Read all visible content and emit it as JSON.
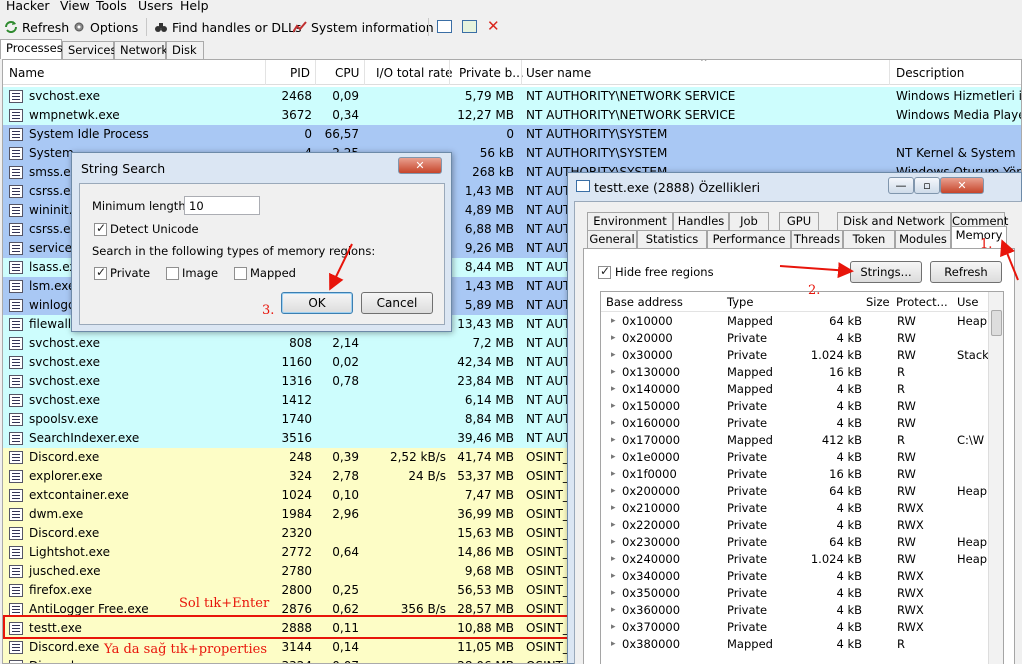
{
  "menu": [
    "Hacker",
    "View",
    "Tools",
    "Users",
    "Help"
  ],
  "toolbar": {
    "refresh": "Refresh",
    "options": "Options",
    "find": "Find handles or DLLs",
    "sysinfo": "System information"
  },
  "tabs": [
    "Processes",
    "Services",
    "Network",
    "Disk"
  ],
  "columns": {
    "name": "Name",
    "pid": "PID",
    "cpu": "CPU",
    "io": "I/O total rate",
    "private": "Private b...",
    "user": "User name",
    "desc": "Description"
  },
  "colors": {
    "service": "#cdfdfd",
    "system": "#a9c8f4",
    "user": "#fdfdc6",
    "highlight": "#e8150b"
  },
  "processes": [
    {
      "name": "svchost.exe",
      "pid": "2468",
      "cpu": "0,09",
      "io": "",
      "priv": "5,79 MB",
      "user": "NT AUTHORITY\\NETWORK SERVICE",
      "desc": "Windows Hizmetleri için",
      "kind": "service"
    },
    {
      "name": "wmpnetwk.exe",
      "pid": "3672",
      "cpu": "0,34",
      "io": "",
      "priv": "12,27 MB",
      "user": "NT AUTHORITY\\NETWORK SERVICE",
      "desc": "Windows Media Player A",
      "kind": "service"
    },
    {
      "name": "System Idle Process",
      "pid": "0",
      "cpu": "66,57",
      "io": "",
      "priv": "0",
      "user": "NT AUTHORITY\\SYSTEM",
      "desc": "",
      "kind": "system"
    },
    {
      "name": "System",
      "pid": "4",
      "cpu": "2,25",
      "io": "",
      "priv": "56 kB",
      "user": "NT AUTHORITY\\SYSTEM",
      "desc": "NT Kernel & System",
      "kind": "system"
    },
    {
      "name": "smss.exe",
      "pid": "",
      "cpu": "",
      "io": "",
      "priv": "268 kB",
      "user": "NT AUTHORITY\\SYSTEM",
      "desc": "Windows Oturum Yönet",
      "kind": "system"
    },
    {
      "name": "csrss.exe",
      "pid": "",
      "cpu": "",
      "io": "",
      "priv": "1,43 MB",
      "user": "NT AUTH",
      "desc": "",
      "kind": "system"
    },
    {
      "name": "wininit.exe",
      "pid": "",
      "cpu": "",
      "io": "",
      "priv": "4,89 MB",
      "user": "NT AUTH",
      "desc": "",
      "kind": "system"
    },
    {
      "name": "csrss.exe",
      "pid": "",
      "cpu": "",
      "io": "",
      "priv": "6,88 MB",
      "user": "NT AUTH",
      "desc": "",
      "kind": "system"
    },
    {
      "name": "services.exe",
      "pid": "",
      "cpu": "",
      "io": "",
      "priv": "9,26 MB",
      "user": "NT AUTH",
      "desc": "",
      "kind": "system"
    },
    {
      "name": "lsass.exe",
      "pid": "",
      "cpu": "",
      "io": "",
      "priv": "8,44 MB",
      "user": "NT AUTH",
      "desc": "",
      "kind": "service"
    },
    {
      "name": "lsm.exe",
      "pid": "",
      "cpu": "",
      "io": "",
      "priv": "1,43 MB",
      "user": "NT AUTH",
      "desc": "",
      "kind": "system"
    },
    {
      "name": "winlogon.exe",
      "pid": "",
      "cpu": "",
      "io": "",
      "priv": "5,89 MB",
      "user": "NT AUTH",
      "desc": "",
      "kind": "system"
    },
    {
      "name": "filewall.exe",
      "pid": "",
      "cpu": "",
      "io": "",
      "priv": "13,43 MB",
      "user": "NT AUTH",
      "desc": "",
      "kind": "service"
    },
    {
      "name": "svchost.exe",
      "pid": "808",
      "cpu": "2,14",
      "io": "",
      "priv": "7,2 MB",
      "user": "NT AUTH",
      "desc": "",
      "kind": "service"
    },
    {
      "name": "svchost.exe",
      "pid": "1160",
      "cpu": "0,02",
      "io": "",
      "priv": "42,34 MB",
      "user": "NT AUTH",
      "desc": "",
      "kind": "service"
    },
    {
      "name": "svchost.exe",
      "pid": "1316",
      "cpu": "0,78",
      "io": "",
      "priv": "23,84 MB",
      "user": "NT AUTH",
      "desc": "",
      "kind": "service"
    },
    {
      "name": "svchost.exe",
      "pid": "1412",
      "cpu": "",
      "io": "",
      "priv": "6,14 MB",
      "user": "NT AUTH",
      "desc": "",
      "kind": "service"
    },
    {
      "name": "spoolsv.exe",
      "pid": "1740",
      "cpu": "",
      "io": "",
      "priv": "8,84 MB",
      "user": "NT AUTH",
      "desc": "",
      "kind": "service"
    },
    {
      "name": "SearchIndexer.exe",
      "pid": "3516",
      "cpu": "",
      "io": "",
      "priv": "39,46 MB",
      "user": "NT AUTH",
      "desc": "",
      "kind": "service"
    },
    {
      "name": "Discord.exe",
      "pid": "248",
      "cpu": "0,39",
      "io": "2,52 kB/s",
      "priv": "41,74 MB",
      "user": "OSINT_",
      "desc": "",
      "kind": "user"
    },
    {
      "name": "explorer.exe",
      "pid": "324",
      "cpu": "2,78",
      "io": "24 B/s",
      "priv": "53,37 MB",
      "user": "OSINT_",
      "desc": "",
      "kind": "user"
    },
    {
      "name": "extcontainer.exe",
      "pid": "1024",
      "cpu": "0,10",
      "io": "",
      "priv": "7,47 MB",
      "user": "OSINT_",
      "desc": "",
      "kind": "user"
    },
    {
      "name": "dwm.exe",
      "pid": "1984",
      "cpu": "2,96",
      "io": "",
      "priv": "36,99 MB",
      "user": "OSINT_",
      "desc": "",
      "kind": "user"
    },
    {
      "name": "Discord.exe",
      "pid": "2320",
      "cpu": "",
      "io": "",
      "priv": "15,63 MB",
      "user": "OSINT_",
      "desc": "",
      "kind": "user"
    },
    {
      "name": "Lightshot.exe",
      "pid": "2772",
      "cpu": "0,64",
      "io": "",
      "priv": "14,86 MB",
      "user": "OSINT_",
      "desc": "",
      "kind": "user"
    },
    {
      "name": "jusched.exe",
      "pid": "2780",
      "cpu": "",
      "io": "",
      "priv": "9,68 MB",
      "user": "OSINT_",
      "desc": "",
      "kind": "user"
    },
    {
      "name": "firefox.exe",
      "pid": "2800",
      "cpu": "0,25",
      "io": "",
      "priv": "56,53 MB",
      "user": "OSINT_",
      "desc": "",
      "kind": "user"
    },
    {
      "name": "AntiLogger Free.exe",
      "pid": "2876",
      "cpu": "0,62",
      "io": "356 B/s",
      "priv": "28,57 MB",
      "user": "OSINT_",
      "desc": "",
      "kind": "user"
    },
    {
      "name": "testt.exe",
      "pid": "2888",
      "cpu": "0,11",
      "io": "",
      "priv": "10,88 MB",
      "user": "OSINT_",
      "desc": "",
      "kind": "user"
    },
    {
      "name": "Discord.exe",
      "pid": "3144",
      "cpu": "0,14",
      "io": "",
      "priv": "11,05 MB",
      "user": "OSINT_",
      "desc": "",
      "kind": "user"
    },
    {
      "name": "Discord.exe",
      "pid": "3324",
      "cpu": "0,07",
      "io": "",
      "priv": "28,06 MB",
      "user": "OSINT_",
      "desc": "",
      "kind": "user"
    }
  ],
  "search_dialog": {
    "title": "String Search",
    "min_length_label": "Minimum length:",
    "min_length_value": "10",
    "detect_unicode": "Detect Unicode",
    "regions_label": "Search in the following types of memory regions:",
    "private": "Private",
    "image": "Image",
    "mapped": "Mapped",
    "ok": "OK",
    "cancel": "Cancel"
  },
  "props_dialog": {
    "title": "testt.exe (2888) Özellikleri",
    "tabs_row1": [
      "Environment",
      "Handles",
      "Job",
      "GPU",
      "Disk and Network",
      "Comment"
    ],
    "tabs_row2": [
      "General",
      "Statistics",
      "Performance",
      "Threads",
      "Token",
      "Modules",
      "Memory"
    ],
    "hide_free": "Hide free regions",
    "strings_btn": "Strings...",
    "refresh_btn": "Refresh",
    "columns": {
      "base": "Base address",
      "type": "Type",
      "size": "Size",
      "protect": "Protect...",
      "use": "Use"
    },
    "regions": [
      {
        "addr": "0x10000",
        "type": "Mapped",
        "size": "64 kB",
        "prot": "RW",
        "use": "Heap"
      },
      {
        "addr": "0x20000",
        "type": "Private",
        "size": "4 kB",
        "prot": "RW",
        "use": ""
      },
      {
        "addr": "0x30000",
        "type": "Private",
        "size": "1.024 kB",
        "prot": "RW",
        "use": "Stack"
      },
      {
        "addr": "0x130000",
        "type": "Mapped",
        "size": "16 kB",
        "prot": "R",
        "use": ""
      },
      {
        "addr": "0x140000",
        "type": "Mapped",
        "size": "4 kB",
        "prot": "R",
        "use": ""
      },
      {
        "addr": "0x150000",
        "type": "Private",
        "size": "4 kB",
        "prot": "RW",
        "use": ""
      },
      {
        "addr": "0x160000",
        "type": "Private",
        "size": "4 kB",
        "prot": "RW",
        "use": ""
      },
      {
        "addr": "0x170000",
        "type": "Mapped",
        "size": "412 kB",
        "prot": "R",
        "use": "C:\\W"
      },
      {
        "addr": "0x1e0000",
        "type": "Private",
        "size": "4 kB",
        "prot": "RW",
        "use": ""
      },
      {
        "addr": "0x1f0000",
        "type": "Private",
        "size": "16 kB",
        "prot": "RW",
        "use": ""
      },
      {
        "addr": "0x200000",
        "type": "Private",
        "size": "64 kB",
        "prot": "RW",
        "use": "Heap"
      },
      {
        "addr": "0x210000",
        "type": "Private",
        "size": "4 kB",
        "prot": "RWX",
        "use": ""
      },
      {
        "addr": "0x220000",
        "type": "Private",
        "size": "4 kB",
        "prot": "RWX",
        "use": ""
      },
      {
        "addr": "0x230000",
        "type": "Private",
        "size": "64 kB",
        "prot": "RW",
        "use": "Heap"
      },
      {
        "addr": "0x240000",
        "type": "Private",
        "size": "1.024 kB",
        "prot": "RW",
        "use": "Heap"
      },
      {
        "addr": "0x340000",
        "type": "Private",
        "size": "4 kB",
        "prot": "RWX",
        "use": ""
      },
      {
        "addr": "0x350000",
        "type": "Private",
        "size": "4 kB",
        "prot": "RWX",
        "use": ""
      },
      {
        "addr": "0x360000",
        "type": "Private",
        "size": "4 kB",
        "prot": "RWX",
        "use": ""
      },
      {
        "addr": "0x370000",
        "type": "Private",
        "size": "4 kB",
        "prot": "RWX",
        "use": ""
      },
      {
        "addr": "0x380000",
        "type": "Mapped",
        "size": "4 kB",
        "prot": "R",
        "use": ""
      }
    ]
  },
  "annotations": {
    "step1": "1.",
    "step2": "2.",
    "step3": "3.",
    "hint_enter": "Sol tık+Enter",
    "hint_properties": "Ya da sağ tık+properties"
  }
}
